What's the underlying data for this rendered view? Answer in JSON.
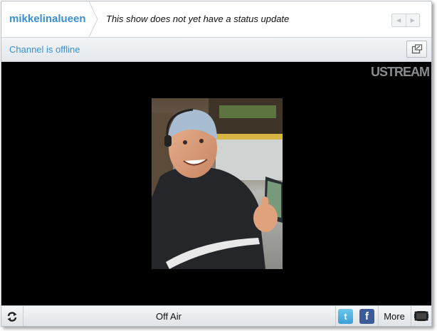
{
  "header": {
    "channel_name": "mikkelinalueen",
    "status_text": "This show does not yet have a status update"
  },
  "infobar": {
    "channel_status": "Channel is offline"
  },
  "video": {
    "logo_text": "USTREAM"
  },
  "controls": {
    "off_air_label": "Off Air",
    "twitter_glyph": "t",
    "facebook_glyph": "f",
    "more_label": "More"
  },
  "icons": {
    "prev": "prev-arrow-icon",
    "next": "next-arrow-icon",
    "popout": "popout-icon",
    "refresh": "refresh-icon",
    "twitter": "twitter-icon",
    "facebook": "facebook-icon",
    "fullscreen": "fullscreen-icon"
  },
  "colors": {
    "accent": "#3a8fd0",
    "twitter": "#3a9fd6",
    "facebook": "#3b5b99",
    "video_bg": "#000000"
  }
}
